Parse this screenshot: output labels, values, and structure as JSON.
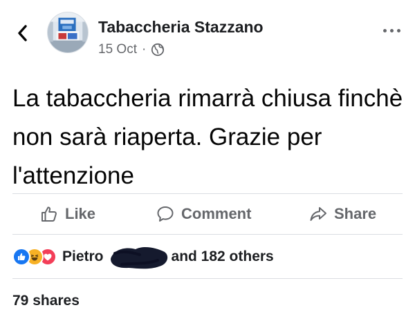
{
  "header": {
    "page_name": "Tabaccheria Stazzano",
    "date": "15 Oct",
    "separator": "·",
    "back_icon": "chevron-left-icon",
    "privacy_icon": "globe-icon",
    "more_icon": "more-horizontal-icon"
  },
  "post": {
    "text": "La tabaccheria rimarrà chiusa finchè non sarà riaperta. Grazie per l'attenzione"
  },
  "actions": {
    "like_label": "Like",
    "comment_label": "Comment",
    "share_label": "Share"
  },
  "reactions": {
    "icons": [
      "like-reaction-icon",
      "haha-reaction-icon",
      "love-reaction-icon"
    ],
    "first_name": "Pietro",
    "others_text": "and 182 others"
  },
  "shares": {
    "text": "79 shares"
  },
  "colors": {
    "text_primary": "#050505",
    "text_secondary": "#65676b",
    "divider": "#dadde1",
    "like_blue": "#1877f2",
    "haha_yellow": "#f7b125",
    "love_red": "#f33e58"
  }
}
